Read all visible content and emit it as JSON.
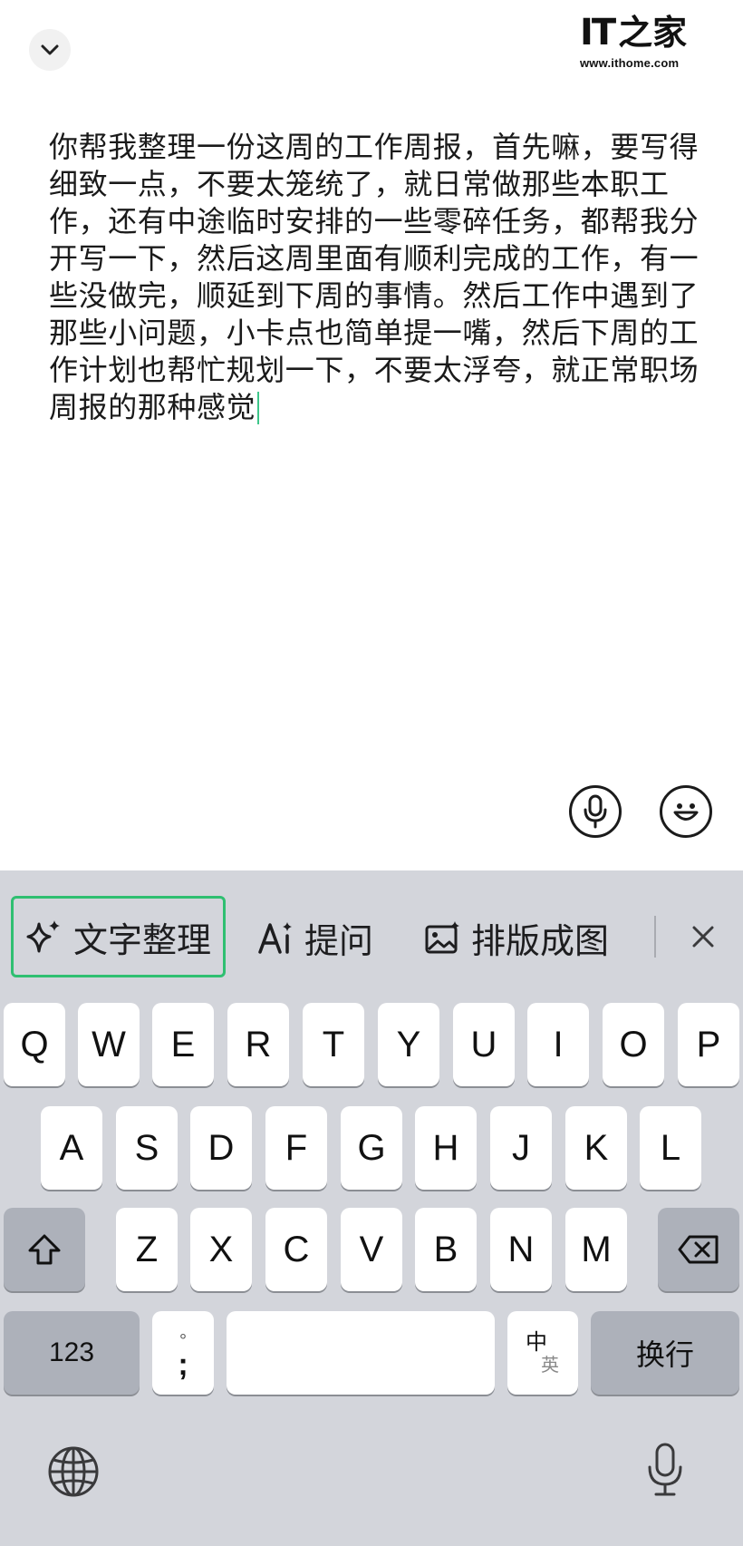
{
  "watermark": {
    "logo_latin": "IT",
    "logo_cn": "之家",
    "site": "www.ithome.com"
  },
  "icons": {
    "collapse": "chevron-down-icon",
    "mic": "microphone-icon",
    "emoji": "smiley-icon",
    "sparkle": "sparkle-icon",
    "ai": "ai-text-icon",
    "image": "image-edit-icon",
    "close": "close-icon",
    "shift": "shift-arrow-icon",
    "backspace": "backspace-icon",
    "globe": "globe-icon",
    "dictation": "microphone-icon"
  },
  "input": {
    "text": "你帮我整理一份这周的工作周报，首先嘛，要写得细致一点，不要太笼统了，就日常做那些本职工作，还有中途临时安排的一些零碎任务，都帮我分开写一下，然后这周里面有顺利完成的工作，有一些没做完，顺延到下周的事情。然后工作中遇到了那些小问题，小卡点也简单提一嘴，然后下周的工作计划也帮忙规划一下，不要太浮夸，就正常职场周报的那种感觉"
  },
  "toolbar": {
    "organize_label": "文字整理",
    "ask_label": "提问",
    "layout_label": "排版成图"
  },
  "keyboard": {
    "row1": [
      "Q",
      "W",
      "E",
      "R",
      "T",
      "Y",
      "U",
      "I",
      "O",
      "P"
    ],
    "row2": [
      "A",
      "S",
      "D",
      "F",
      "G",
      "H",
      "J",
      "K",
      "L"
    ],
    "row3": [
      "Z",
      "X",
      "C",
      "V",
      "B",
      "N",
      "M"
    ],
    "numbers_label": "123",
    "punct_top": "°",
    "punct_bottom": ";",
    "lang_cn": "中",
    "lang_en": "英",
    "return_label": "换行"
  },
  "colors": {
    "highlight_border": "#2fbf71",
    "caret": "#3ec68a",
    "keyboard_bg": "#d3d5db",
    "key_bg": "#ffffff",
    "special_key_bg": "#adb1ba"
  }
}
